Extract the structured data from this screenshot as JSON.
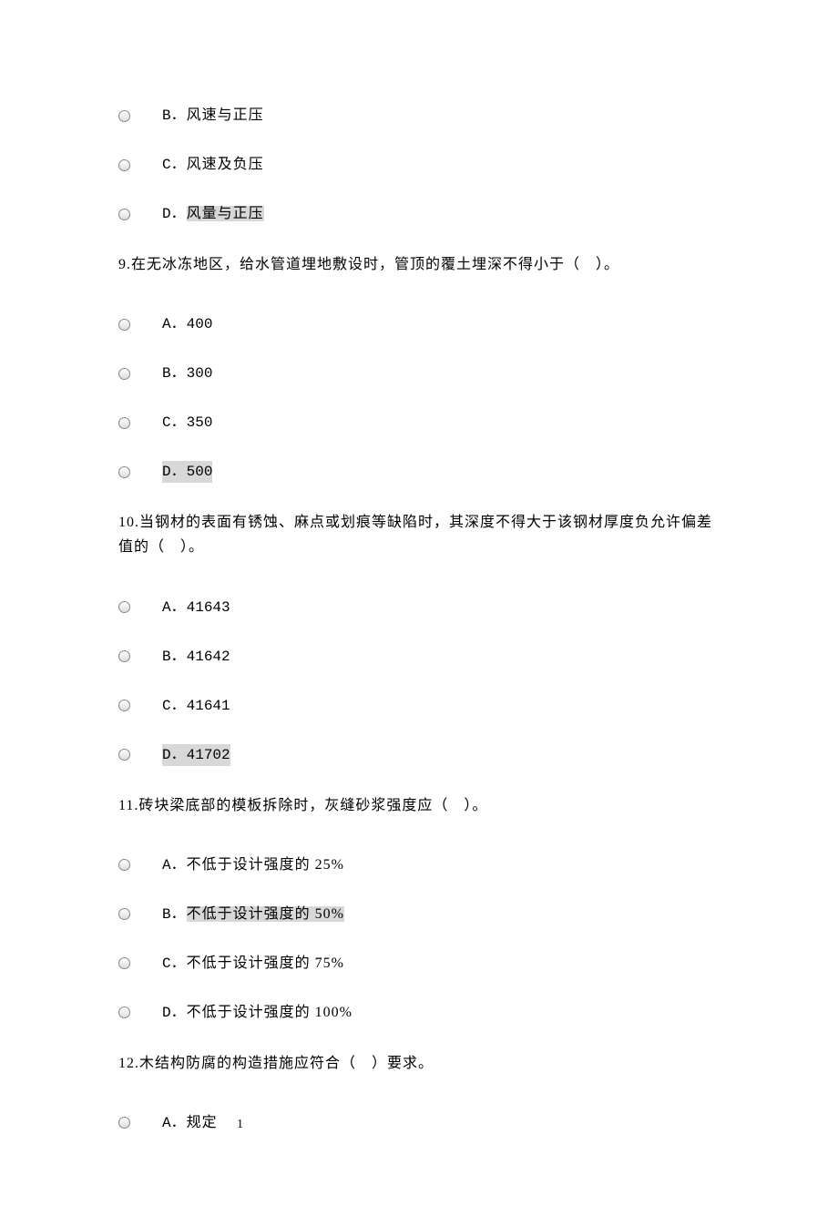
{
  "q8_partial": {
    "options": [
      {
        "letter": "B",
        "text": "风速与正压",
        "highlighted": false
      },
      {
        "letter": "C",
        "text": "风速及负压",
        "highlighted": false
      },
      {
        "letter": "D",
        "text": "风量与正压",
        "highlighted": true
      }
    ]
  },
  "q9": {
    "number": "9.",
    "text": "在无冰冻地区，给水管道埋地敷设时，管顶的覆土埋深不得小于（　）。",
    "options": [
      {
        "letter": "A",
        "text": "400",
        "highlighted": false
      },
      {
        "letter": "B",
        "text": "300",
        "highlighted": false
      },
      {
        "letter": "C",
        "text": "350",
        "highlighted": false
      },
      {
        "letter": "D",
        "text": "500",
        "highlighted": true
      }
    ]
  },
  "q10": {
    "number": "10.",
    "text": "当钢材的表面有锈蚀、麻点或划痕等缺陷时，其深度不得大于该钢材厚度负允许偏差值的（　）。",
    "options": [
      {
        "letter": "A",
        "text": "41643",
        "highlighted": false
      },
      {
        "letter": "B",
        "text": "41642",
        "highlighted": false
      },
      {
        "letter": "C",
        "text": "41641",
        "highlighted": false
      },
      {
        "letter": "D",
        "text": "41702",
        "highlighted": true
      }
    ]
  },
  "q11": {
    "number": "11.",
    "text": "砖块梁底部的模板拆除时，灰缝砂浆强度应（　）。",
    "options": [
      {
        "letter": "A",
        "text": "不低于设计强度的 25%",
        "highlighted": false
      },
      {
        "letter": "B",
        "text": "不低于设计强度的 50%",
        "highlighted": true
      },
      {
        "letter": "C",
        "text": "不低于设计强度的 75%",
        "highlighted": false
      },
      {
        "letter": "D",
        "text": "不低于设计强度的 100%",
        "highlighted": false
      }
    ]
  },
  "q12": {
    "number": "12.",
    "text": "木结构防腐的构造措施应符合（　）要求。",
    "options": [
      {
        "letter": "A",
        "text": "规定",
        "highlighted": false
      }
    ]
  },
  "page_number": "1"
}
